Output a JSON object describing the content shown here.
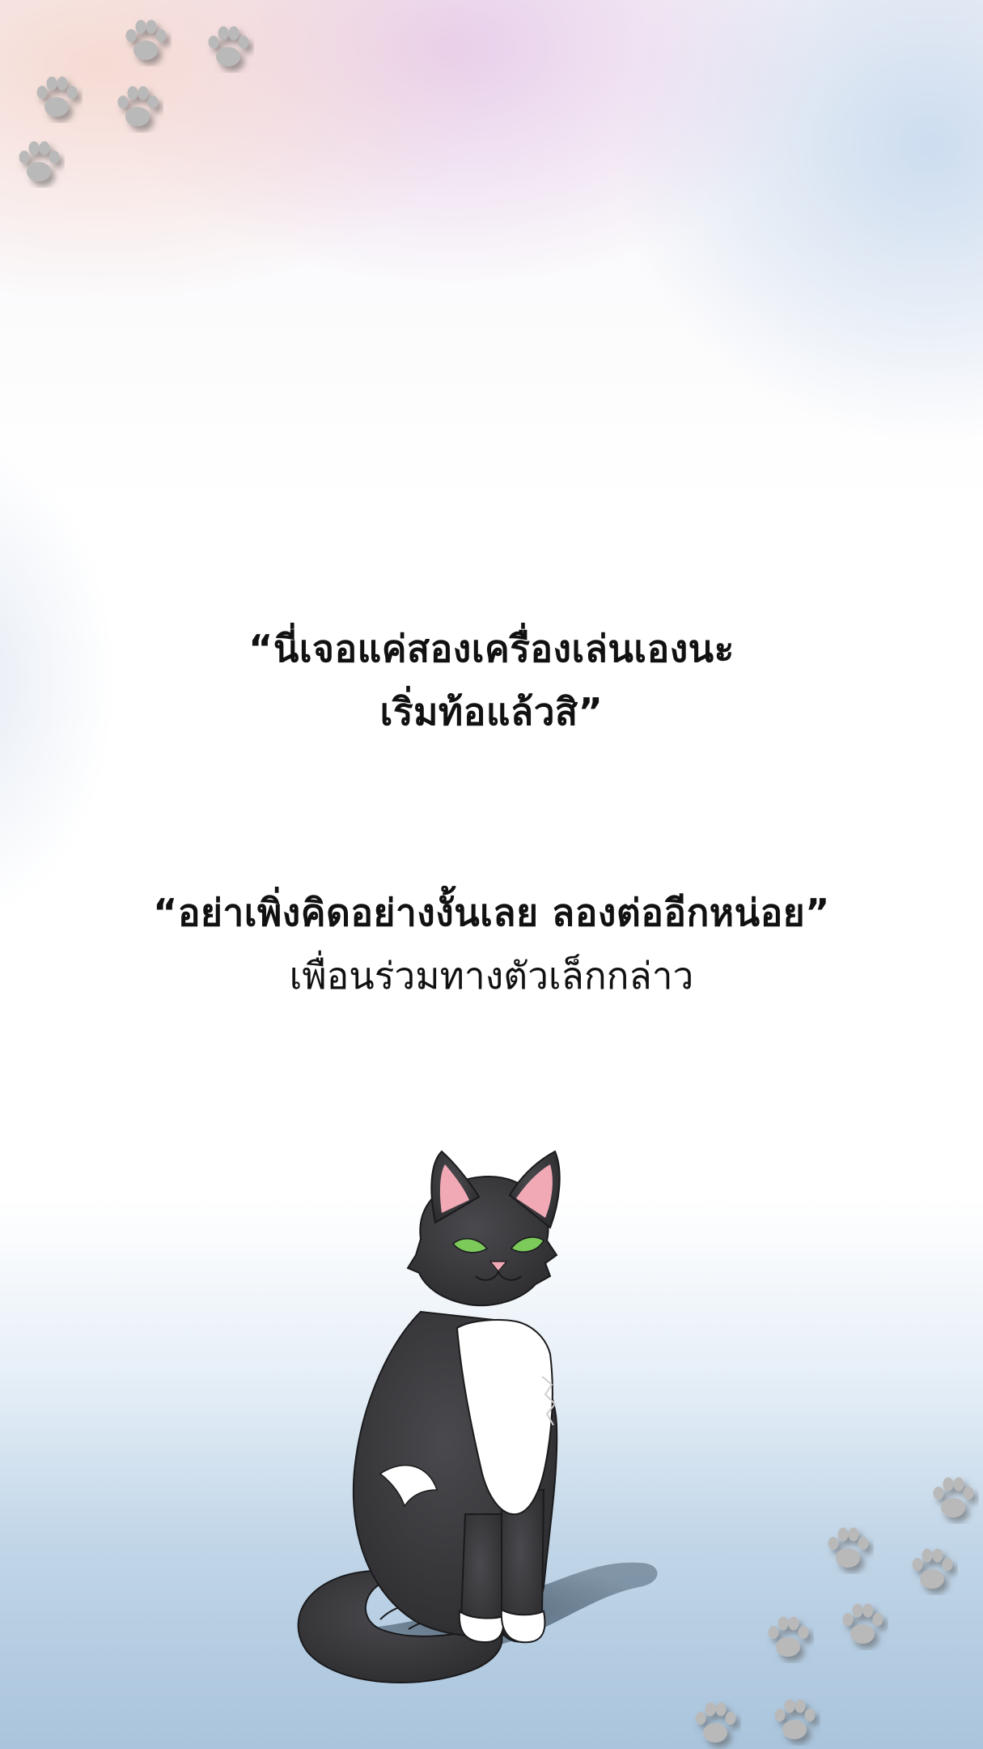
{
  "dialogue": {
    "first_quote": {
      "line1": "“นี่เจอแค่สองเครื่องเล่นเองนะ",
      "line2": "เริ่มท้อแล้วสิ”"
    },
    "second_quote": {
      "line1": "“อย่าเพิ่งคิดอย่างงั้นเลย ลองต่ออีกหน่อย”",
      "narration": "เพื่อนร่วมทางตัวเล็กกล่าว"
    }
  },
  "illustration": {
    "subject": "black-and-white-cat-icon",
    "decoration": "paw-print-icon"
  },
  "colors": {
    "text": "#111111",
    "cat_fur": "#3b3b3e",
    "cat_chest": "#ffffff",
    "cat_eyes": "#7ccb5a",
    "cat_ear_inner": "#f2a9b6",
    "paw_print": "#b9b9b9",
    "sky_top_pink": "#f6d6cd",
    "sky_top_violet": "#e6c8e8",
    "floor_blue": "#a9c4dc"
  }
}
